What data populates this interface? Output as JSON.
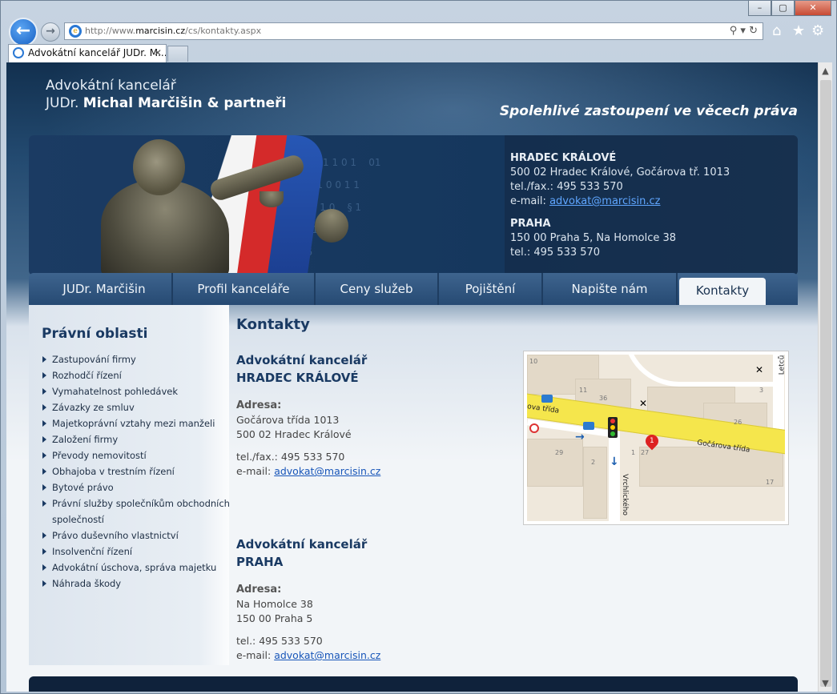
{
  "browser": {
    "url_prefix": "http://www.",
    "url_domain": "marcisin.cz",
    "url_path": "/cs/kontakty.aspx",
    "tab_title": "Advokátní kancelář JUDr. M...",
    "window_buttons": [
      "–",
      "▢",
      "✕"
    ]
  },
  "header": {
    "brand_line1": "Advokátní kancelář",
    "brand_prefix": "JUDr.",
    "brand_name": "Michal Marčišin & partneři",
    "slogan": "Spolehlivé zastoupení ve věcech práva"
  },
  "hero_info": {
    "hk_title": "HRADEC KRÁLOVÉ",
    "hk_address": "500 02 Hradec Králové, Gočárova tř. 1013",
    "hk_phone": "tel./fax.: 495 533 570",
    "hk_email_label": "e-mail:",
    "hk_email": "advokat@marcisin.cz",
    "praha_title": "PRAHA",
    "praha_address": "150 00 Praha 5, Na Homolce 38",
    "praha_phone": "tel.: 495 533 570"
  },
  "nav": {
    "items": [
      "JUDr. Marčišin",
      "Profil kanceláře",
      "Ceny služeb",
      "Pojištění",
      "Napište nám",
      "Kontakty"
    ],
    "active": "Kontakty"
  },
  "sidebar": {
    "title": "Právní oblasti",
    "items": [
      "Zastupování firmy",
      "Rozhodčí řízení",
      "Vymahatelnost pohledávek",
      "Závazky ze smluv",
      "Majetkoprávní vztahy mezi manželi",
      "Založení firmy",
      "Převody nemovitostí",
      "Obhajoba v trestním řízení",
      "Bytové právo",
      "Právní služby společníkům obchodních společností",
      "Právo duševního vlastnictví",
      "Insolvenční řízení",
      "Advokátní úschova, správa majetku",
      "Náhrada škody"
    ]
  },
  "main": {
    "title": "Kontakty",
    "hk": {
      "heading1": "Advokátní kancelář",
      "heading2": "HRADEC KRÁLOVÉ",
      "address_label": "Adresa:",
      "street": "Gočárova třída 1013",
      "city": "500 02 Hradec Králové",
      "phone": "tel./fax.: 495 533 570",
      "email_label": "e-mail:",
      "email": "advokat@marcisin.cz"
    },
    "praha": {
      "heading1": "Advokátní kancelář",
      "heading2": "PRAHA",
      "address_label": "Adresa:",
      "street": "Na Homolce 38",
      "city": "150 00 Praha 5",
      "phone": "tel.: 495 533 570",
      "email_label": "e-mail:",
      "email": "advokat@marcisin.cz"
    }
  },
  "map": {
    "street_main": "Gočárova třída",
    "street_left": "ova třída",
    "street_side": "Vrchlického",
    "street_top": "Letců",
    "marker": "1",
    "numbers": [
      "10",
      "11",
      "36",
      "26",
      "29",
      "2",
      "1",
      "27",
      "17",
      "3"
    ]
  }
}
